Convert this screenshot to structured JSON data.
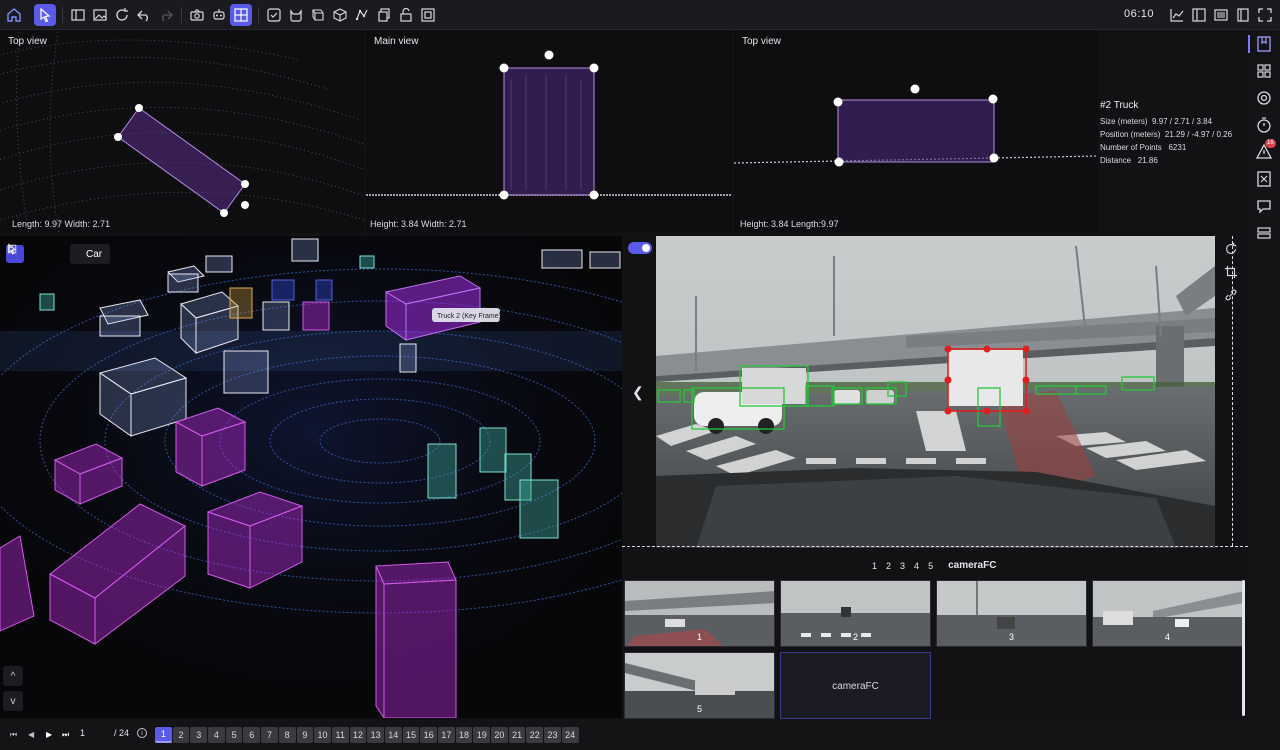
{
  "toolbar": {
    "clock": "06:10",
    "icons": [
      "home-icon",
      "select-tool-icon",
      "sidebar-icon",
      "image-icon",
      "refresh-icon",
      "undo-icon",
      "redo-icon",
      "camera-icon",
      "robot-icon",
      "grid-layout-icon",
      "fit-icon",
      "cat-icon",
      "cube-multi-icon",
      "cube-icon",
      "polyline-icon",
      "copy-icon",
      "lock-open-icon",
      "frame-icon",
      "chart-icon",
      "layout-icon",
      "list-icon",
      "book-icon",
      "expand-icon"
    ]
  },
  "views": {
    "top_left": {
      "title": "Top view",
      "footer": "Length: 9.97  Width: 2.71"
    },
    "main": {
      "title": "Main view",
      "footer": "Height: 3.84  Width: 2.71"
    },
    "top_right": {
      "title": "Top view",
      "footer": "Height: 3.84  Length:9.97"
    }
  },
  "object_info": {
    "title": "#2  Truck",
    "size_label": "Size (meters)",
    "size_value": "9.97  /  2.71  /  3.84",
    "position_label": "Position (meters)",
    "position_value": "21.29  /  -4.97  /  0.26",
    "points_label": "Number of Points",
    "points_value": "6231",
    "distance_label": "Distance",
    "distance_value": "21.86"
  },
  "scene3d": {
    "class_select": "Car",
    "key_frame_label": "Truck 2 (Key Frame)",
    "zoom_up": "^",
    "zoom_down": "v"
  },
  "sidebar": {
    "badge": "16"
  },
  "camera": {
    "tabs": [
      "1",
      "2",
      "3",
      "4",
      "5"
    ],
    "current": "cameraFC",
    "thumbnails": [
      "1",
      "2",
      "3",
      "4",
      "5"
    ],
    "current_thumb_label": "cameraFC"
  },
  "timeline": {
    "current_frame": "1",
    "total": "/ 24",
    "frames": [
      "1",
      "2",
      "3",
      "4",
      "5",
      "6",
      "7",
      "8",
      "9",
      "10",
      "11",
      "12",
      "13",
      "14",
      "15",
      "16",
      "17",
      "18",
      "19",
      "20",
      "21",
      "22",
      "23",
      "24"
    ],
    "active_frame": "1"
  },
  "colors": {
    "accent": "#5b5bea",
    "annotation_purple": "#9b3dd0",
    "magenta": "#b22bd0",
    "teal": "#4fc0b0",
    "bbox_green": "#26c73a",
    "bbox_red": "#e02020"
  }
}
